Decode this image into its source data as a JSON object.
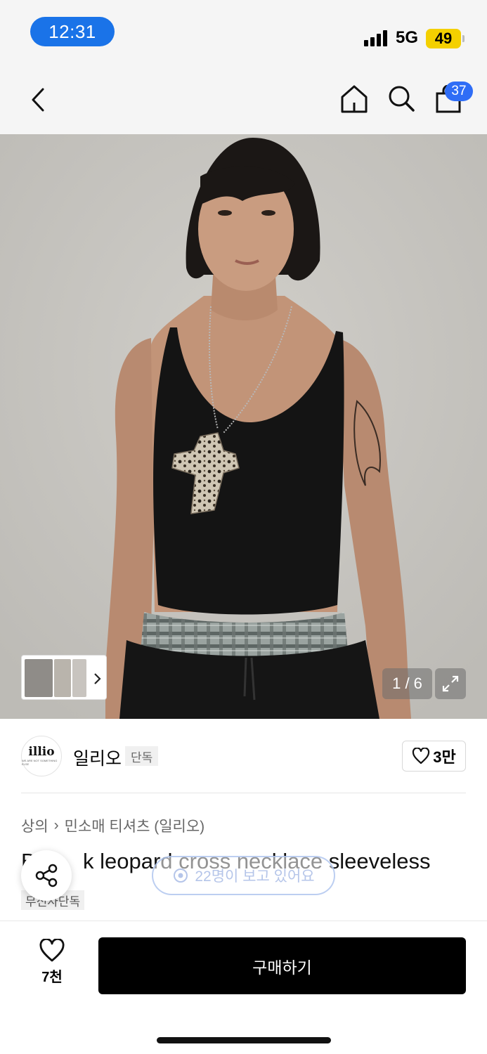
{
  "status_bar": {
    "time": "12:31",
    "network": "5G",
    "battery": "49"
  },
  "nav": {
    "cart_count": "37"
  },
  "gallery": {
    "counter": "1 / 6"
  },
  "brand": {
    "logo_text": "illio",
    "logo_sub": "WE ARE NOT SOMETHING ELSE",
    "name": "일리오",
    "tag": "단독",
    "likes": "3만"
  },
  "breadcrumb": {
    "category": "상의",
    "separator": "›",
    "subcategory": "민소매 티셔츠 (일리오)"
  },
  "product": {
    "title_head": "B",
    "title_visible": "k leopard cross necklace sleeveless",
    "exclusive_tag": "무신사단독"
  },
  "overlay": {
    "viewers_text": "22명이 보고 있어요"
  },
  "bottom_bar": {
    "wish_count": "7천",
    "buy_label": "구매하기"
  },
  "colors": {
    "accent_blue": "#1a73e8",
    "badge_blue": "#2f6df6",
    "battery_yellow": "#f4d000",
    "buy_black": "#000000"
  }
}
